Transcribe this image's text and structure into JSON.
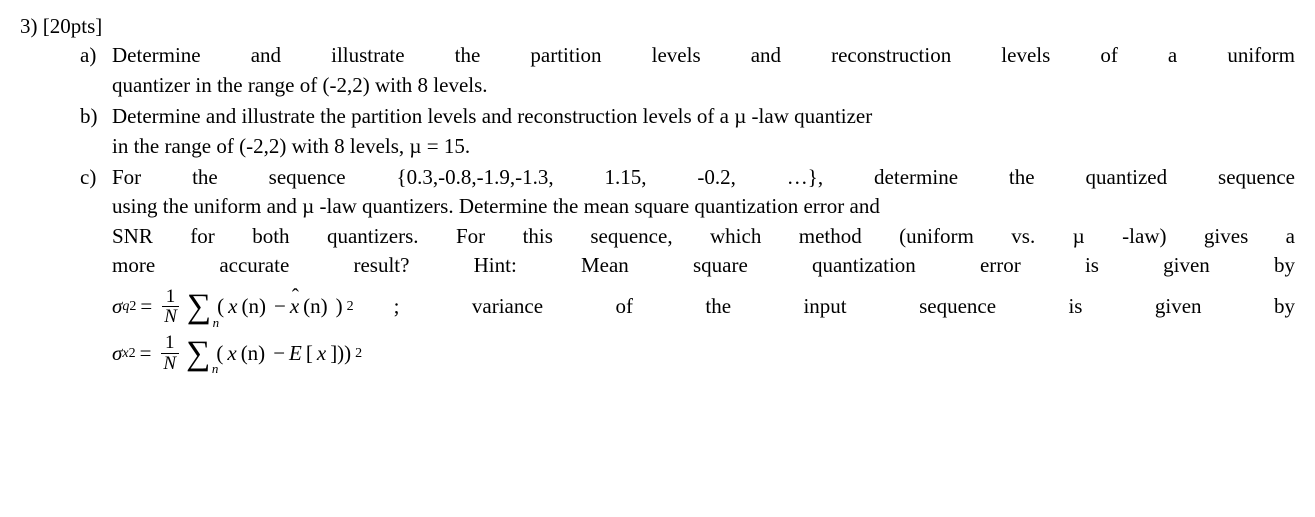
{
  "question": {
    "number": "3)",
    "points": "[20pts]"
  },
  "parts": {
    "a": {
      "label": "a)",
      "text_line1": "Determine and illustrate the partition levels and reconstruction levels of a uniform",
      "text_line2": "quantizer in the range of (-2,2) with 8 levels."
    },
    "b": {
      "label": "b)",
      "text_line1": "Determine and illustrate the partition levels and reconstruction levels of a  µ -law quantizer",
      "text_line2": "in the range of (-2,2) with 8 levels,  µ = 15."
    },
    "c": {
      "label": "c)",
      "text_line1": "For the sequence {0.3,-0.8,-1.9,-1.3, 1.15, -0.2, …}, determine the quantized sequence",
      "text_line2": "using the uniform and µ -law quantizers. Determine the mean square quantization error and",
      "text_line3": "SNR for both quantizers. For this sequence, which method (uniform vs. µ -law) gives a",
      "text_line4": "more accurate result? Hint: Mean square quantization error is given by",
      "formula1": {
        "lhs_var": "σ",
        "lhs_sub": "q",
        "lhs_sup": "2",
        "eq": "=",
        "frac_num": "1",
        "frac_den": "N",
        "sum_sub": "n",
        "paren_open": "(",
        "x": "x",
        "n1": "(n)",
        "minus": "−",
        "xhat": "x",
        "n2": "(n)",
        "paren_close": ")",
        "outer_sup": "2"
      },
      "between_text": "; variance of the input sequence is given by",
      "formula2": {
        "lhs_var": "σ",
        "lhs_sub": "x",
        "lhs_sup": "2",
        "eq": "=",
        "frac_num": "1",
        "frac_den": "N",
        "sum_sub": "n",
        "paren_open": "(",
        "x": "x",
        "n1": "(n)",
        "minus": "−",
        "E": "E",
        "bracket_open": "[",
        "x2": "x",
        "bracket_close": "]))",
        "outer_sup": "2"
      }
    }
  }
}
